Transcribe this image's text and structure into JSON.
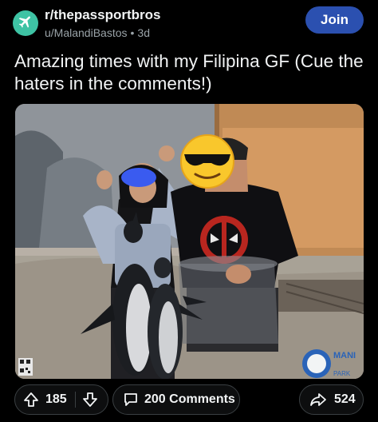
{
  "post": {
    "subreddit": "r/thepassportbros",
    "author": "u/MalandiBastos",
    "separator": "•",
    "age": "3d",
    "join_label": "Join",
    "title": "Amazing times with my Filipina GF (Cue the haters in the comments!)"
  },
  "image": {
    "watermark_text_1": "MANI",
    "watermark_text_2": "PARK",
    "subjects": [
      "penguins",
      "woman",
      "man",
      "rock-wall-backdrop"
    ],
    "emoji": "smiling-face-with-sunglasses",
    "blur_color": "#3a5bf0"
  },
  "actions": {
    "upvote_count": "185",
    "comments_label": "200 Comments",
    "share_count": "524"
  },
  "colors": {
    "background": "#000000",
    "join_button": "#2b50b0",
    "subreddit_avatar": "#3ec3a4",
    "meta_text": "#9aa3a8"
  },
  "icons": {
    "subreddit": "airplane-icon",
    "upvote": "arrow-up-icon",
    "downvote": "arrow-down-icon",
    "comments": "speech-bubble-icon",
    "share": "share-arrow-icon"
  }
}
